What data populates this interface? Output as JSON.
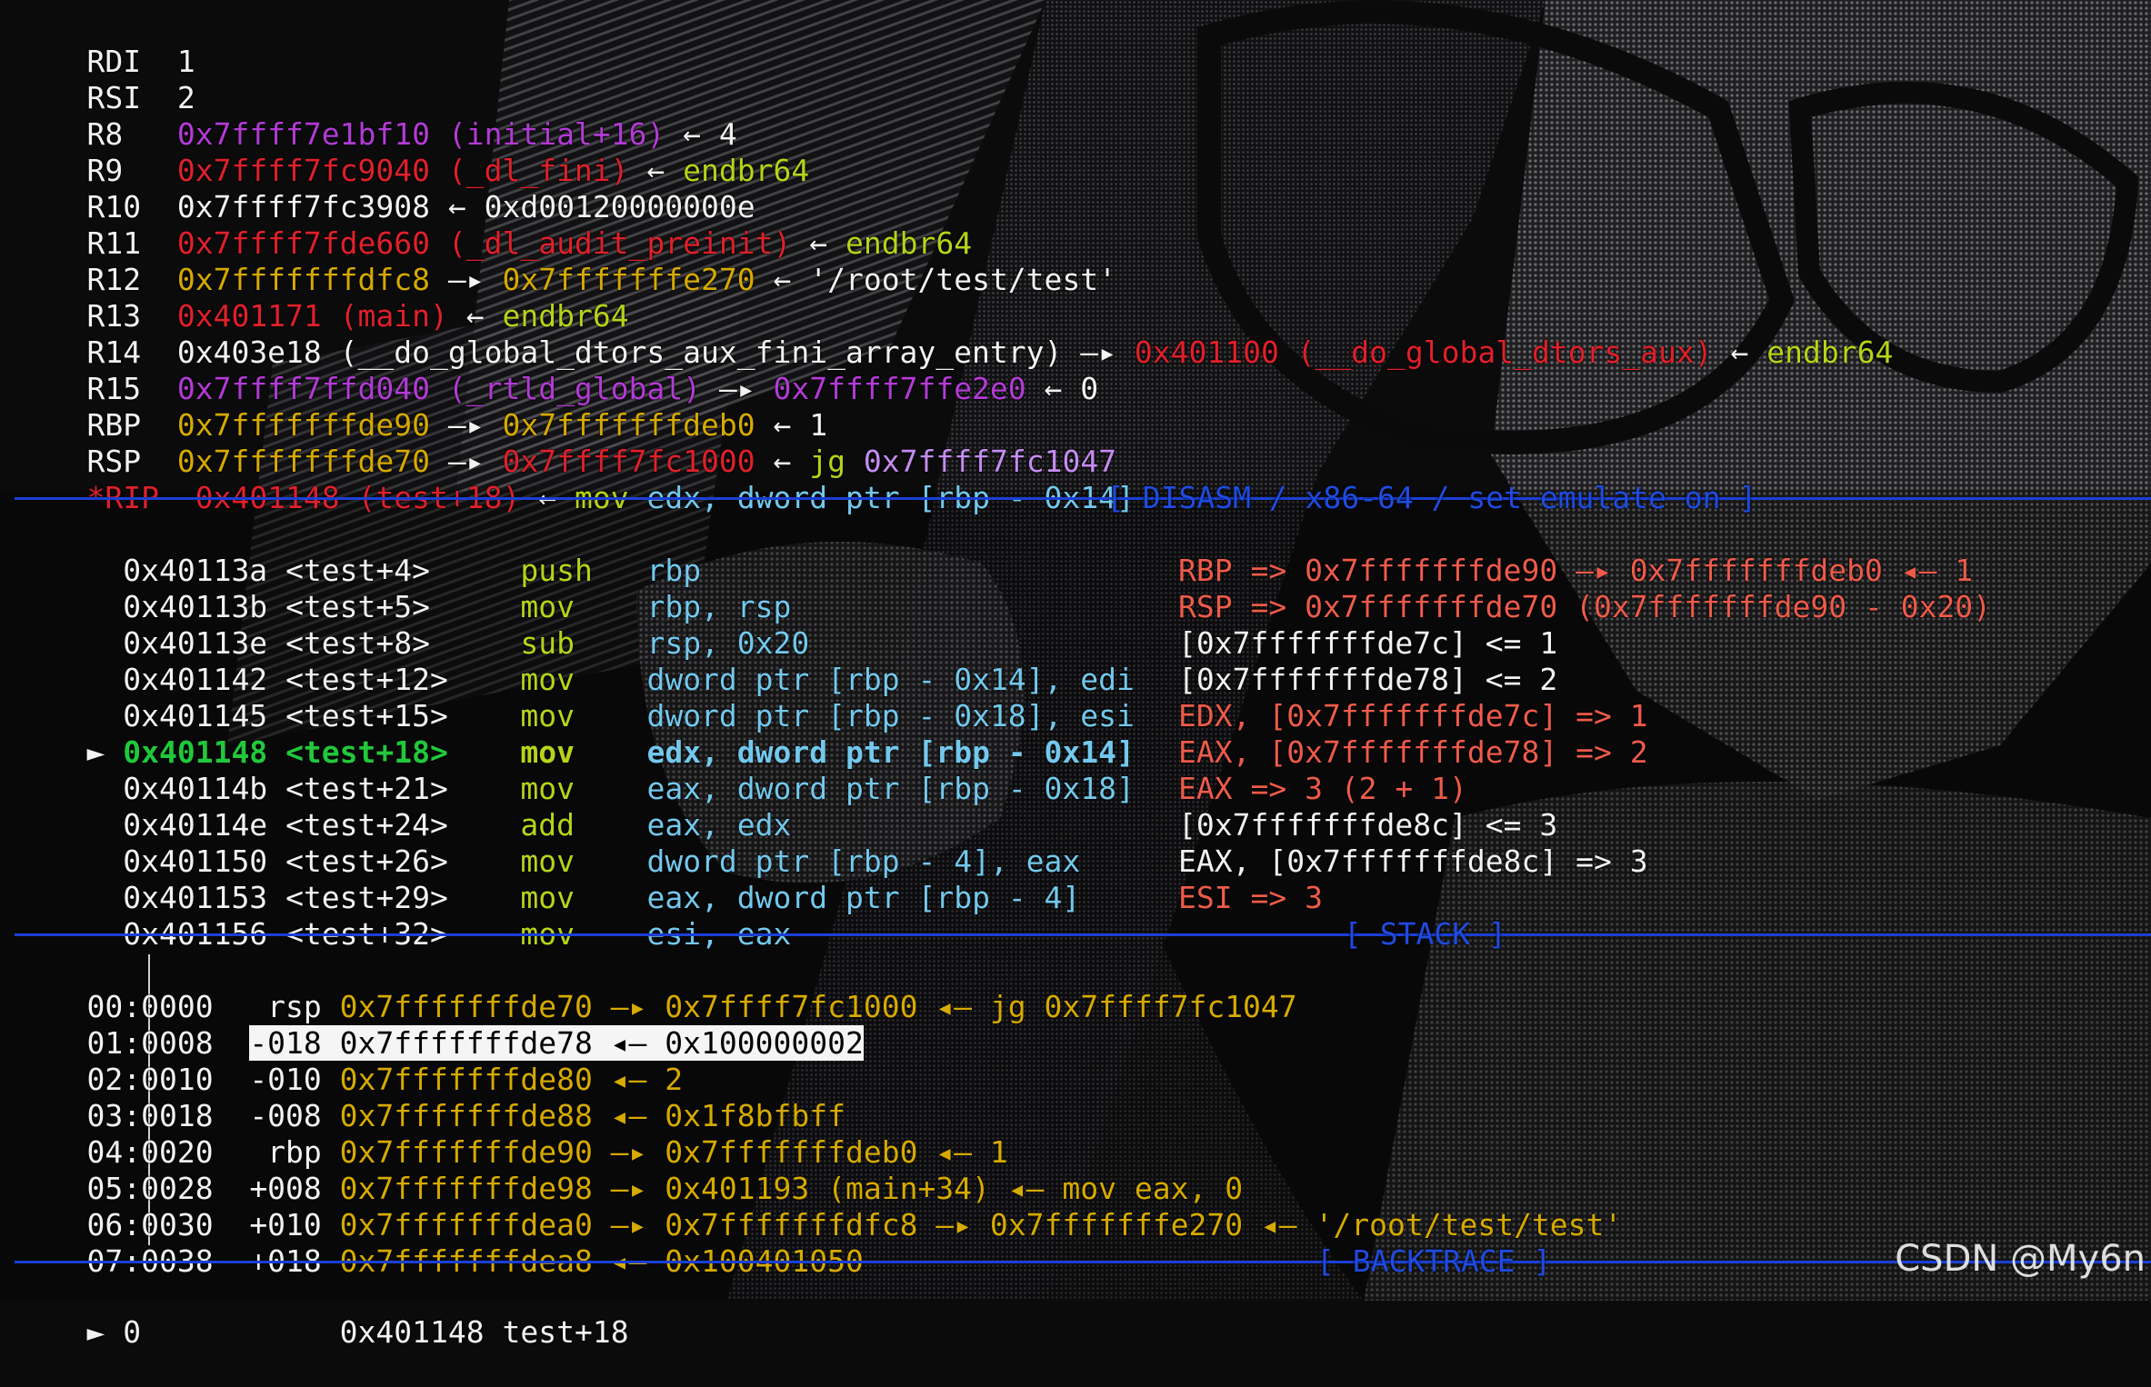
{
  "colors": {
    "background": "#0b0b0c",
    "rule": "#1b3fd6",
    "header": "#1f4be0",
    "addr_code": "#e0202a",
    "addr_stack": "#d6aa00",
    "addr_lib": "#b33bd6",
    "string": "#f2f2f2",
    "instr_arrow": "#b8d318",
    "register": "#73c8ec",
    "number": "#c58cf2",
    "current": "#21c83b"
  },
  "registers": [
    {
      "name": "RDI",
      "value": "1"
    },
    {
      "name": "RSI",
      "value": "2"
    },
    {
      "name": "R8",
      "value": "0x7ffff7e1bf10 (initial+16)",
      "deref": "← 4"
    },
    {
      "name": "R9",
      "value": "0x7ffff7fc9040 (_dl_fini)",
      "deref": "←",
      "instr": "endbr64"
    },
    {
      "name": "R10",
      "value": "0x7ffff7fc3908",
      "deref": "← 0xd00120000000e"
    },
    {
      "name": "R11",
      "value": "0x7ffff7fde660 (_dl_audit_preinit)",
      "deref": "←",
      "instr": "endbr64"
    },
    {
      "name": "R12",
      "value": "0x7fffffffdfc8",
      "arrow": "—▸",
      "target": "0x7fffffffe270",
      "deref": "← '/root/test/test'"
    },
    {
      "name": "R13",
      "value": "0x401171 (main)",
      "deref": "←",
      "instr": "endbr64"
    },
    {
      "name": "R14",
      "value": "0x403e18 (__do_global_dtors_aux_fini_array_entry)",
      "arrow": "—▸",
      "target": "0x401100 (__do_global_dtors_aux)",
      "deref": "←",
      "instr": "endbr64"
    },
    {
      "name": "R15",
      "value": "0x7ffff7ffd040 (_rtld_global)",
      "arrow": "—▸",
      "target": "0x7ffff7ffe2e0",
      "deref": "← 0"
    },
    {
      "name": "RBP",
      "value": "0x7fffffffde90",
      "arrow": "—▸",
      "target": "0x7fffffffdeb0",
      "deref": "← 1"
    },
    {
      "name": "RSP",
      "value": "0x7fffffffde70",
      "arrow": "—▸",
      "target": "0x7ffff7fc1000",
      "deref": "←",
      "instr": "jg",
      "instr_arg": "0x7ffff7fc1047"
    },
    {
      "name": "*RIP",
      "value": "0x401148 (test+18)",
      "deref": "←",
      "instr": "mov",
      "ops": "edx, dword ptr [rbp - 0x14]"
    }
  ],
  "disasm": {
    "header": "[ DISASM / x86-64 / set emulate on ]",
    "rows": [
      {
        "addr": "0x40113a",
        "sym": "<test+4>",
        "op": "push",
        "args": "rbp",
        "emu": ""
      },
      {
        "addr": "0x40113b",
        "sym": "<test+5>",
        "op": "mov",
        "args": "rbp, rsp",
        "emu": "RBP => 0x7fffffffde90 —▸ 0x7fffffffdeb0 ◂— 1"
      },
      {
        "addr": "0x40113e",
        "sym": "<test+8>",
        "op": "sub",
        "args": "rsp, 0x20",
        "emu": "RSP => 0x7fffffffde70 (0x7fffffffde90 - 0x20)"
      },
      {
        "addr": "0x401142",
        "sym": "<test+12>",
        "op": "mov",
        "args": "dword ptr [rbp - 0x14], edi",
        "emu": "[0x7fffffffde7c] <= 1"
      },
      {
        "addr": "0x401145",
        "sym": "<test+15>",
        "op": "mov",
        "args": "dword ptr [rbp - 0x18], esi",
        "emu": "[0x7fffffffde78] <= 2"
      },
      {
        "addr": "0x401148",
        "sym": "<test+18>",
        "op": "mov",
        "args": "edx, dword ptr [rbp - 0x14]",
        "emu": "EDX, [0x7fffffffde7c] => 1",
        "current": true
      },
      {
        "addr": "0x40114b",
        "sym": "<test+21>",
        "op": "mov",
        "args": "eax, dword ptr [rbp - 0x18]",
        "emu": "EAX, [0x7fffffffde78] => 2"
      },
      {
        "addr": "0x40114e",
        "sym": "<test+24>",
        "op": "add",
        "args": "eax, edx",
        "emu": "EAX => 3 (2 + 1)"
      },
      {
        "addr": "0x401150",
        "sym": "<test+26>",
        "op": "mov",
        "args": "dword ptr [rbp - 4], eax",
        "emu": "[0x7fffffffde8c] <= 3"
      },
      {
        "addr": "0x401153",
        "sym": "<test+29>",
        "op": "mov",
        "args": "eax, dword ptr [rbp - 4]",
        "emu": "EAX, [0x7fffffffde8c] => 3"
      },
      {
        "addr": "0x401156",
        "sym": "<test+32>",
        "op": "mov",
        "args": "esi, eax",
        "emu": "ESI => 3"
      }
    ],
    "marker": "►"
  },
  "stack": {
    "header": "[ STACK ]",
    "rows": [
      {
        "idx": "00:0000",
        "off": " rsp",
        "text": "0x7fffffffde70 —▸ 0x7ffff7fc1000 ◂— jg 0x7ffff7fc1047"
      },
      {
        "idx": "01:0008",
        "off": "-018",
        "text": "0x7fffffffde78 ◂— 0x100000002",
        "highlight": true
      },
      {
        "idx": "02:0010",
        "off": "-010",
        "text": "0x7fffffffde80 ◂— 2"
      },
      {
        "idx": "03:0018",
        "off": "-008",
        "text": "0x7fffffffde88 ◂— 0x1f8bfbff"
      },
      {
        "idx": "04:0020",
        "off": " rbp",
        "text": "0x7fffffffde90 —▸ 0x7fffffffdeb0 ◂— 1"
      },
      {
        "idx": "05:0028",
        "off": "+008",
        "text": "0x7fffffffde98 —▸ 0x401193 (main+34) ◂— mov eax, 0"
      },
      {
        "idx": "06:0030",
        "off": "+010",
        "text": "0x7fffffffdea0 —▸ 0x7fffffffdfc8 —▸ 0x7fffffffe270 ◂— '/root/test/test'"
      },
      {
        "idx": "07:0038",
        "off": "+018",
        "text": "0x7fffffffdea8 ◂— 0x100401050"
      }
    ]
  },
  "backtrace": {
    "header": "[ BACKTRACE ]",
    "rows": [
      {
        "marker": "►",
        "frame": "0",
        "addr": "0x401148",
        "sym": "test+18"
      }
    ]
  },
  "watermark": "CSDN @My6n"
}
